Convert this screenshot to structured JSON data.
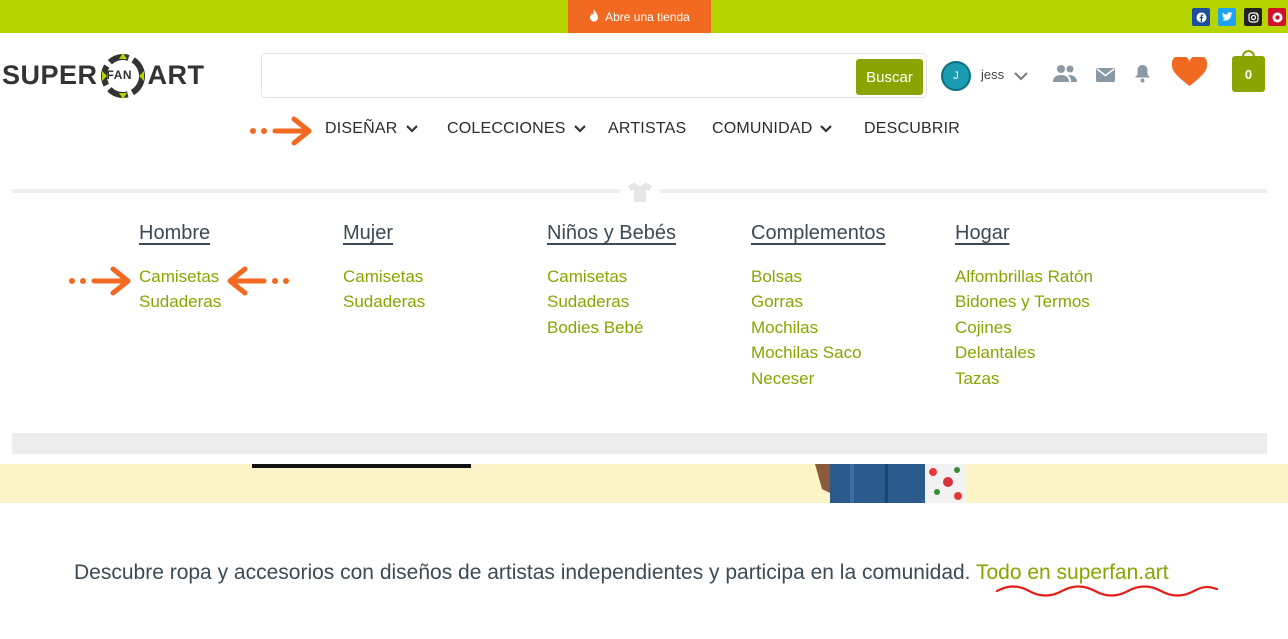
{
  "topbar": {
    "open_shop_label": "Abre una tienda",
    "social": [
      "facebook-icon",
      "twitter-icon",
      "instagram-icon",
      "pinterest-icon"
    ]
  },
  "logo": {
    "left_text": "SUPER",
    "ring_text": "FAN",
    "right_text": "ART"
  },
  "search": {
    "placeholder": "",
    "button_label": "Buscar"
  },
  "user": {
    "initial": "J",
    "name": "jess"
  },
  "cart": {
    "count": "0"
  },
  "nav": {
    "items": [
      {
        "label": "DISEÑAR",
        "dropdown": true
      },
      {
        "label": "COLECCIONES",
        "dropdown": true
      },
      {
        "label": "ARTISTAS",
        "dropdown": false
      },
      {
        "label": "COMUNIDAD",
        "dropdown": true
      },
      {
        "label": "DESCUBRIR",
        "dropdown": false
      }
    ]
  },
  "mega_menu": {
    "columns": [
      {
        "title": "Hombre",
        "links": [
          "Camisetas",
          "Sudaderas"
        ]
      },
      {
        "title": "Mujer",
        "links": [
          "Camisetas",
          "Sudaderas"
        ]
      },
      {
        "title": "Niños y Bebés",
        "links": [
          "Camisetas",
          "Sudaderas",
          "Bodies Bebé"
        ]
      },
      {
        "title": "Complementos",
        "links": [
          "Bolsas",
          "Gorras",
          "Mochilas",
          "Mochilas Saco",
          "Neceser"
        ]
      },
      {
        "title": "Hogar",
        "links": [
          "Alfombrillas Ratón",
          "Bidones y Termos",
          "Cojines",
          "Delantales",
          "Tazas"
        ]
      }
    ]
  },
  "tagline": {
    "text": "Descubre ropa y accesorios con diseños de artistas independientes y participa en la comunidad. ",
    "link": "Todo en superfan.art"
  },
  "colors": {
    "topbar": "#b5d400",
    "accent_orange": "#f26a21",
    "brand_green": "#8aa400",
    "annotation_red": "#e0201b"
  }
}
